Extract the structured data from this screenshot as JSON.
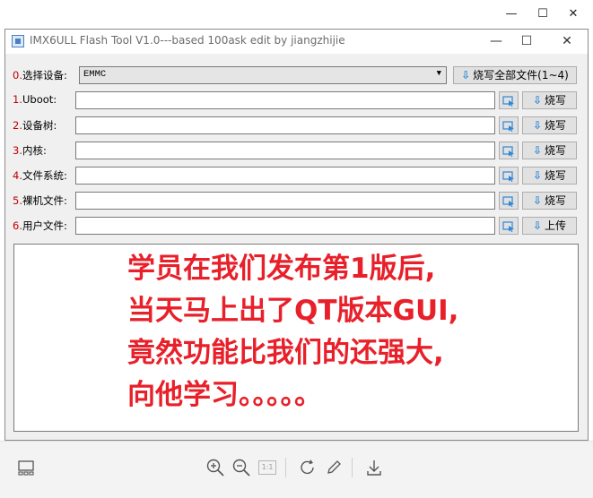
{
  "outer_window": {
    "controls": {
      "minimize": "—",
      "maximize": "☐",
      "close": "✕"
    }
  },
  "app": {
    "title": "IMX6ULL Flash Tool V1.0---based 100ask edit by jiangzhijie",
    "controls": {
      "minimize": "—",
      "maximize": "☐",
      "close": "✕"
    }
  },
  "device_row": {
    "num": "0.",
    "label": "选择设备:",
    "selected": "EMMC",
    "flash_all_label": "烧写全部文件(1~4)"
  },
  "rows": [
    {
      "num": "1.",
      "label": "Uboot:",
      "value": "",
      "action": "烧写"
    },
    {
      "num": "2.",
      "label": "设备树:",
      "value": "",
      "action": "烧写"
    },
    {
      "num": "3.",
      "label": "内核:",
      "value": "",
      "action": "烧写"
    },
    {
      "num": "4.",
      "label": "文件系统:",
      "value": "",
      "action": "烧写"
    },
    {
      "num": "5.",
      "label": "裸机文件:",
      "value": "",
      "action": "烧写"
    },
    {
      "num": "6.",
      "label": "用户文件:",
      "value": "",
      "action": "上传"
    }
  ],
  "log": {
    "text": "学员在我们发布第1版后,\n当天马上出了QT版本GUI,\n竟然功能比我们的还强大,\n向他学习。。。。。"
  },
  "toolbar": {
    "icons": [
      "layout-icon",
      "zoom-in-icon",
      "zoom-out-icon",
      "actual-size-icon",
      "rotate-icon",
      "edit-icon",
      "download-icon"
    ],
    "actual_size_label": "1:1"
  },
  "colors": {
    "accent_red": "#e8202a",
    "number_red": "#c00000",
    "icon_blue": "#2f86d6"
  }
}
